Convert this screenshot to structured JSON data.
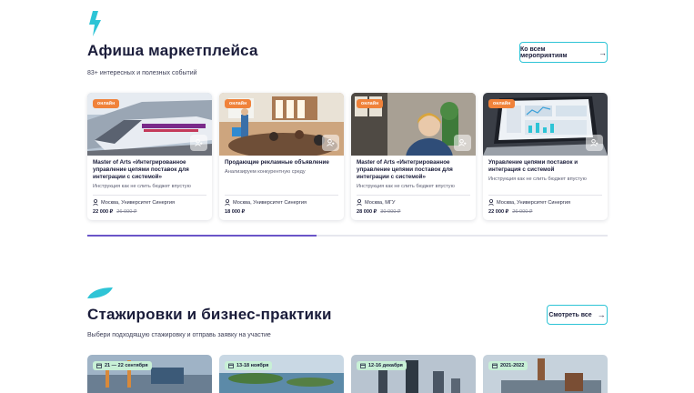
{
  "events": {
    "title": "Афиша маркетплейса",
    "subtitle": "83+ интересных и полезных событий",
    "all_button": "Ко всем мероприятиям",
    "cards": [
      {
        "badge": "онлайн",
        "title": "Master of Arts «Интегрированное управление цепями поставок для интеграции с системой»",
        "description": "Инструкция как не слить бюджет впустую",
        "location": "Москва, Университет Синергия",
        "price": "22 000 ₽",
        "old_price": "26 000 ₽"
      },
      {
        "badge": "онлайн",
        "title": "Продающие рекламные объявление",
        "description": "Анализируем конкурентную среду",
        "location": "Москва, Университет Синергия",
        "price": "18 000 ₽",
        "old_price": ""
      },
      {
        "badge": "онлайн",
        "title": "Master of Arts «Интегрированное управление цепями поставок для интеграции с системой»",
        "description": "Инструкция как не слить бюджет впустую",
        "location": "Москва, МГУ",
        "price": "28 000 ₽",
        "old_price": "30 000 ₽"
      },
      {
        "badge": "онлайн",
        "title": "Управление цепями поставок и интеграция с системой",
        "description": "Инструкция как не слить бюджет впустую",
        "location": "Москва, Университет Синергия",
        "price": "22 000 ₽",
        "old_price": "26 000 ₽"
      }
    ],
    "scroll_progress": 0.44
  },
  "internships": {
    "title": "Стажировки и бизнес-практики",
    "subtitle": "Выбери подходящую стажировку и отправь заявку на участие",
    "see_all_button": "Смотреть все",
    "cards": [
      {
        "date": "21 — 22 сентября"
      },
      {
        "date": "13-18 ноября"
      },
      {
        "date": "12-16 декабря"
      },
      {
        "date": "2021-2022"
      }
    ]
  },
  "colors": {
    "accent_cyan": "#2ec4d6",
    "badge_orange": "#f0823a",
    "progress_purple": "#6a55c8",
    "date_badge_green": "#c8f0d6"
  },
  "icons": {
    "logo": "lightning-bolt-icon",
    "arrow": "arrow-right-icon",
    "add_user": "add-user-icon",
    "location": "location-pin-icon",
    "calendar": "calendar-icon",
    "leaf": "leaf-icon"
  }
}
